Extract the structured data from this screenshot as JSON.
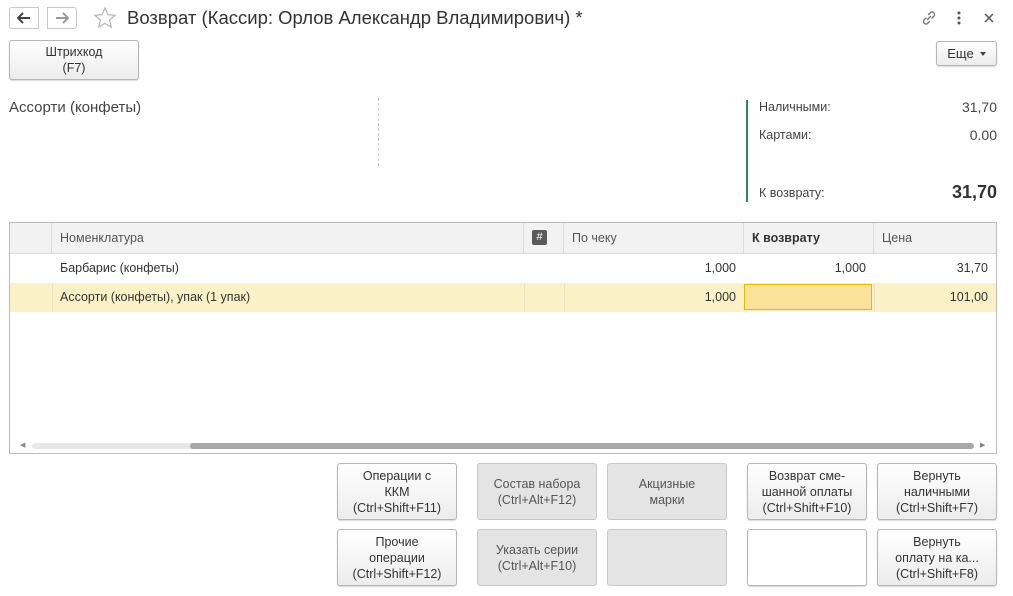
{
  "window": {
    "title": "Возврат (Кассир: Орлов Александр Владимирович) *",
    "icons": [
      "back-arrow-icon",
      "forward-arrow-icon",
      "star-icon",
      "link-icon",
      "more-vertical-icon",
      "close-icon"
    ]
  },
  "toolbar": {
    "barcode_label": "Штрихкод",
    "barcode_hotkey": "(F7)",
    "more_label": "Еще"
  },
  "info": {
    "product": "Ассорти (конфеты)",
    "payment": {
      "cash_label": "Наличными:",
      "cash_value": "31,70",
      "cards_label": "Картами:",
      "cards_value": "0.00",
      "total_label": "К возврату:",
      "total_value": "31,70"
    },
    "accent_color": "#2e8b57"
  },
  "table": {
    "columns": {
      "name": "Номенклатура",
      "hash": "#",
      "by_receipt": "По чеку",
      "to_return": "К возврату",
      "price": "Цена"
    },
    "rows": [
      {
        "name": "Барбарис (конфеты)",
        "by_receipt": "1,000",
        "to_return": "1,000",
        "price": "31,70",
        "selected": false
      },
      {
        "name": "Ассорти (конфеты), упак (1 упак)",
        "by_receipt": "1,000",
        "to_return": "",
        "price": "101,00",
        "selected": true
      }
    ],
    "selected_row_color": "#fbf1c6"
  },
  "actions": {
    "kkm_ops": {
      "line1": "Операции с",
      "line2": "ККМ",
      "line3": "(Ctrl+Shift+F11)"
    },
    "kit": {
      "line1": "Состав набора",
      "line2": "(Ctrl+Alt+F12)"
    },
    "excise": {
      "line1": "Акцизные",
      "line2": "марки"
    },
    "mixed_return": {
      "line1": "Возврат сме-",
      "line2": "шанной оплаты",
      "line3": "(Ctrl+Shift+F10)"
    },
    "return_cash": {
      "line1": "Вернуть",
      "line2": "наличными",
      "line3": "(Ctrl+Shift+F7)"
    },
    "other_ops": {
      "line1": "Прочие",
      "line2": "операции",
      "line3": "(Ctrl+Shift+F12)"
    },
    "series": {
      "line1": "Указать серии",
      "line2": "(Ctrl+Alt+F10)"
    },
    "return_card": {
      "line1": "Вернуть",
      "line2": "оплату на ка...",
      "line3": "(Ctrl+Shift+F8)"
    }
  }
}
